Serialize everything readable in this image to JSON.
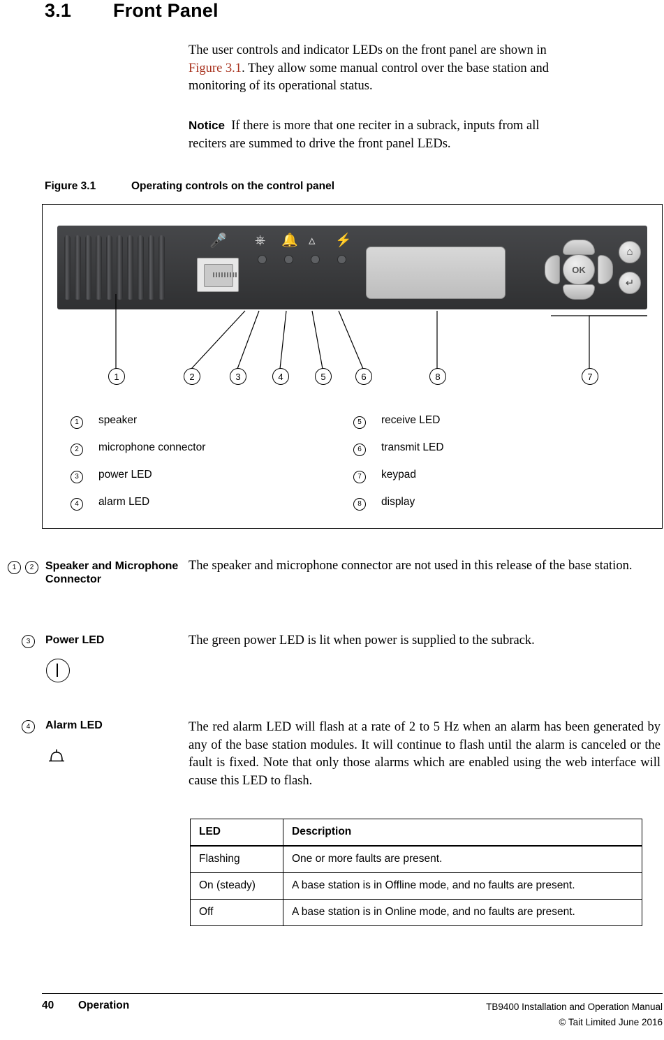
{
  "heading": {
    "number": "3.1",
    "title": "Front Panel"
  },
  "intro": {
    "line1_a": "The user controls and indicator LEDs on the front panel are shown in",
    "link": "Figure 3.1",
    "line2_b": ". They allow some manual control over the base station and",
    "line3": "monitoring of its operational status."
  },
  "notice": {
    "label": "Notice",
    "text_line1": "If there is more that one reciter in a subrack, inputs from all",
    "text_line2": "reciters are summed to drive the front panel LEDs."
  },
  "figure": {
    "label": "Figure 3.1",
    "caption": "Operating controls on the control panel",
    "keypad_ok_label": "OK",
    "callouts": [
      "1",
      "2",
      "3",
      "4",
      "5",
      "6",
      "7",
      "8"
    ],
    "legend": [
      {
        "num": "1",
        "label": "speaker"
      },
      {
        "num": "5",
        "label": "receive LED"
      },
      {
        "num": "2",
        "label": "microphone connector"
      },
      {
        "num": "6",
        "label": "transmit LED"
      },
      {
        "num": "3",
        "label": "power LED"
      },
      {
        "num": "7",
        "label": "keypad"
      },
      {
        "num": "4",
        "label": "alarm LED"
      },
      {
        "num": "8",
        "label": "display"
      }
    ]
  },
  "blocks": [
    {
      "nums": [
        "1",
        "2"
      ],
      "title": "Speaker and Microphone Connector",
      "body": "The speaker and microphone connector are not used in this release of the base station."
    },
    {
      "nums": [
        "3"
      ],
      "title": "Power LED",
      "body": "The green power LED is lit when power is supplied to the subrack."
    },
    {
      "nums": [
        "4"
      ],
      "title": "Alarm LED",
      "body": "The red alarm LED will flash at a rate of 2 to 5 Hz when an alarm has been generated by any of the base station modules. It will continue to flash until the alarm is canceled or the fault is fixed. Note that only those alarms which are enabled using the web interface will cause this LED to flash."
    }
  ],
  "table": {
    "headers": [
      "LED",
      "Description"
    ],
    "rows": [
      [
        "Flashing",
        "One or more faults are present."
      ],
      [
        "On (steady)",
        "A base station is in Offline mode, and no faults are present."
      ],
      [
        "Off",
        "A base station is in Online mode, and no faults are present."
      ]
    ]
  },
  "footer": {
    "page": "40",
    "section": "Operation",
    "manual": "TB9400 Installation and Operation Manual",
    "copyright": "© Tait Limited June 2016"
  }
}
